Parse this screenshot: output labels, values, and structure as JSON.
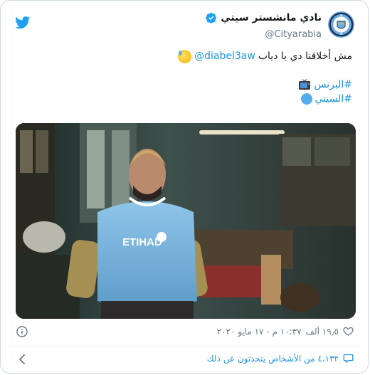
{
  "author": {
    "display_name": "نادي مانشستر سيتي",
    "handle": "@Cityarabia",
    "verified": true,
    "avatar_icon": "man-city-crest-icon"
  },
  "tweet": {
    "line1_text": "مش أخلاقنا دي يا دياب",
    "line1_mention": "@diabel3aw",
    "line1_emoji": "sweat-smile-emoji",
    "line2_hashtag": "#البرنس",
    "line2_emoji": "television-emoji",
    "line3_hashtag": "#السيتي",
    "line3_emoji": "blue-circle-emoji"
  },
  "footer": {
    "likes": "١٩٫٥ ألف",
    "timestamp": "١٠:٣٧ م - ١٧ مايو ٢٠٢٠",
    "conversation": "٤،١٣٢ من الأشخاص يتحدثون عن ذلك"
  },
  "colors": {
    "link": "#1b95e0",
    "muted": "#657786",
    "twitter_blue": "#1da1f2",
    "city_blue": "#6cabdd"
  }
}
